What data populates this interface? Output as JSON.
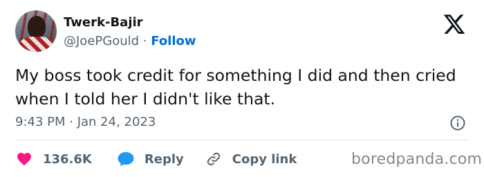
{
  "author": {
    "display_name": "Twerk-Bajir",
    "handle": "@JoePGould",
    "separator": "·",
    "follow_label": "Follow",
    "avatar_icon": "profile-photo"
  },
  "platform_logo": "x-logo-icon",
  "tweet": {
    "text": "My boss took credit for something I did and then cried when I told her I didn't like that.",
    "timestamp": "9:43 PM · Jan 24, 2023"
  },
  "actions": {
    "likes": "136.6K",
    "reply_label": "Reply",
    "copy_link_label": "Copy link"
  },
  "icons": {
    "like": "heart-icon",
    "reply": "speech-bubble-icon",
    "copy_link": "link-icon",
    "info": "info-icon"
  },
  "colors": {
    "text": "#0f1419",
    "secondary": "#536471",
    "follow": "#006fd6",
    "like": "#f91880",
    "reply": "#1d9bf0"
  },
  "watermark": "boredpanda.com"
}
